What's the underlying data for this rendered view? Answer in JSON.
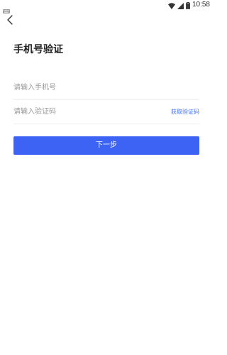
{
  "status_bar": {
    "time": "10:58",
    "icons": [
      "keyboard-icon",
      "wifi-icon",
      "signal-icon",
      "battery-icon"
    ]
  },
  "header": {
    "back_icon": "chevron-left-icon"
  },
  "page": {
    "title": "手机号验证"
  },
  "form": {
    "phone_placeholder": "请输入手机号",
    "phone_value": "",
    "code_placeholder": "请输入验证码",
    "code_value": "",
    "get_code_label": "获取验证码",
    "next_label": "下一步"
  },
  "colors": {
    "accent": "#3d63f4",
    "link": "#3f6ef7",
    "placeholder": "#9a9a9a",
    "title": "#222222",
    "divider": "#eeeeee"
  }
}
